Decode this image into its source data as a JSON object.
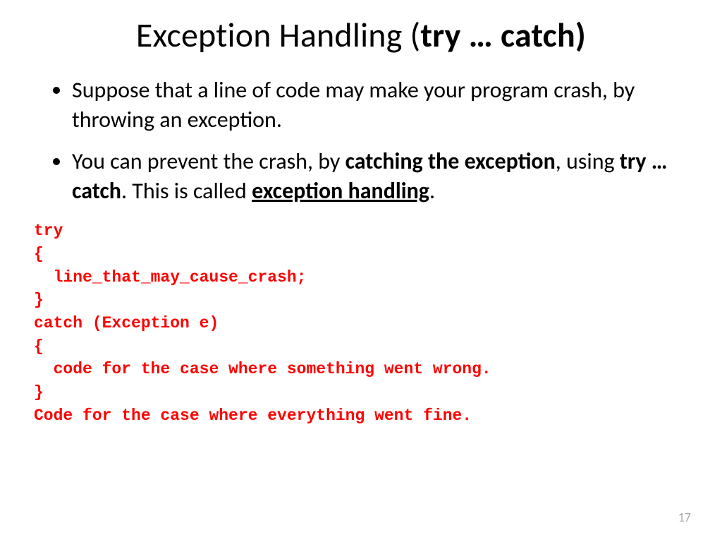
{
  "title": {
    "prefix": "Exception Handling (",
    "bold": "try … catch)"
  },
  "bullets": [
    {
      "segments": [
        {
          "text": "Suppose that a line of code may make your program crash, by throwing an exception.",
          "style": "plain"
        }
      ]
    },
    {
      "segments": [
        {
          "text": "You can prevent the crash, by ",
          "style": "plain"
        },
        {
          "text": "catching the exception",
          "style": "bold"
        },
        {
          "text": ", using ",
          "style": "plain"
        },
        {
          "text": "try … catch",
          "style": "bold"
        },
        {
          "text": ". This is called ",
          "style": "plain"
        },
        {
          "text": "exception handling",
          "style": "bold-underline"
        },
        {
          "text": ".",
          "style": "plain"
        }
      ]
    }
  ],
  "code_lines": [
    "try",
    "{",
    "  line_that_may_cause_crash;",
    "}",
    "catch (Exception e)",
    "{",
    "  code for the case where something went wrong.",
    "}",
    "Code for the case where everything went fine."
  ],
  "page_number": "17"
}
